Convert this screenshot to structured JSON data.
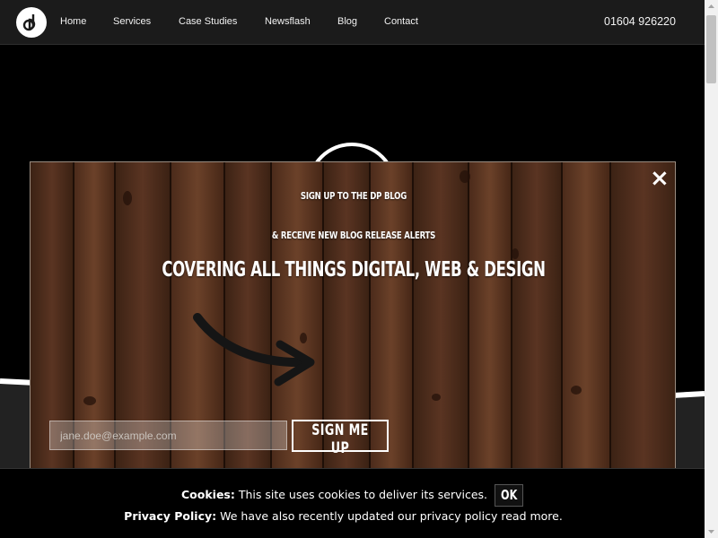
{
  "nav": {
    "items": [
      {
        "label": "Home"
      },
      {
        "label": "Services"
      },
      {
        "label": "Case Studies"
      },
      {
        "label": "Newsflash"
      },
      {
        "label": "Blog"
      },
      {
        "label": "Contact"
      }
    ],
    "phone": "01604 926220"
  },
  "modal": {
    "line1": "Sign up to the DP Blog",
    "line2": "& receive new blog release alerts",
    "line3": "Covering all things Digital, Web & Design",
    "email_placeholder": "jane.doe@example.com",
    "email_value": "",
    "signup_label": "SIGN ME UP",
    "close_symbol": "×",
    "arrow_icon": "arrow-right-icon"
  },
  "cookie": {
    "cookies_label": "Cookies:",
    "cookies_text": "This site uses cookies to deliver its services.",
    "ok_label": "OK",
    "privacy_label": "Privacy Policy:",
    "privacy_text": "We have also recently updated our privacy policy read more."
  },
  "colors": {
    "nav_bg": "#1b1b1b",
    "wood": "#4a2a18",
    "text": "#ffffff"
  }
}
